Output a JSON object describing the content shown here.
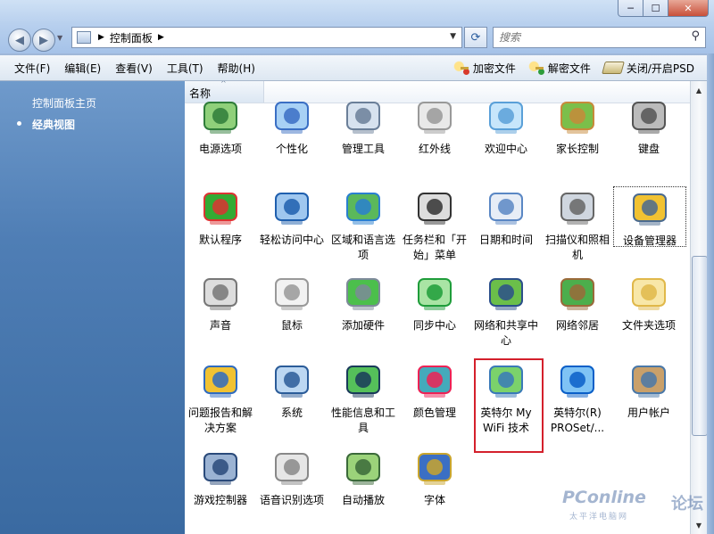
{
  "window": {
    "min": "─",
    "max": "☐",
    "close": "✕"
  },
  "nav": {
    "back": "◀",
    "forward": "▶"
  },
  "address": {
    "path": "控制面板"
  },
  "search": {
    "placeholder": "搜索"
  },
  "menu": [
    "文件(F)",
    "编辑(E)",
    "查看(V)",
    "工具(T)",
    "帮助(H)"
  ],
  "toolbar": {
    "encrypt": "加密文件",
    "decrypt": "解密文件",
    "psd": "关闭/开启PSD"
  },
  "sidebar": {
    "home": "控制面板主页",
    "classic": "经典视图"
  },
  "columns": {
    "name": "名称"
  },
  "icons": [
    {
      "label": "电源选项",
      "icon": "power-options-icon"
    },
    {
      "label": "个性化",
      "icon": "personalization-icon"
    },
    {
      "label": "管理工具",
      "icon": "admin-tools-icon"
    },
    {
      "label": "红外线",
      "icon": "infrared-icon"
    },
    {
      "label": "欢迎中心",
      "icon": "welcome-center-icon"
    },
    {
      "label": "家长控制",
      "icon": "parental-controls-icon"
    },
    {
      "label": "键盘",
      "icon": "keyboard-icon"
    },
    {
      "label": "默认程序",
      "icon": "default-programs-icon"
    },
    {
      "label": "轻松访问中心",
      "icon": "ease-of-access-icon"
    },
    {
      "label": "区域和语言选项",
      "icon": "region-language-icon"
    },
    {
      "label": "任务栏和「开始」菜单",
      "icon": "taskbar-start-icon"
    },
    {
      "label": "日期和时间",
      "icon": "date-time-icon"
    },
    {
      "label": "扫描仪和照相机",
      "icon": "scanner-camera-icon"
    },
    {
      "label": "设备管理器",
      "icon": "device-manager-icon"
    },
    {
      "label": "声音",
      "icon": "sound-icon"
    },
    {
      "label": "鼠标",
      "icon": "mouse-icon"
    },
    {
      "label": "添加硬件",
      "icon": "add-hardware-icon"
    },
    {
      "label": "同步中心",
      "icon": "sync-center-icon"
    },
    {
      "label": "网络和共享中心",
      "icon": "network-sharing-icon"
    },
    {
      "label": "网络邻居",
      "icon": "network-places-icon"
    },
    {
      "label": "文件夹选项",
      "icon": "folder-options-icon"
    },
    {
      "label": "问题报告和解决方案",
      "icon": "problem-reports-icon"
    },
    {
      "label": "系统",
      "icon": "system-icon"
    },
    {
      "label": "性能信息和工具",
      "icon": "performance-icon"
    },
    {
      "label": "颜色管理",
      "icon": "color-management-icon"
    },
    {
      "label": "英特尔 My WiFi 技术",
      "icon": "intel-my-wifi-icon"
    },
    {
      "label": "英特尔(R) PROSet/...",
      "icon": "intel-proset-icon"
    },
    {
      "label": "用户帐户",
      "icon": "user-accounts-icon"
    },
    {
      "label": "游戏控制器",
      "icon": "game-controllers-icon"
    },
    {
      "label": "语音识别选项",
      "icon": "speech-recognition-icon"
    },
    {
      "label": "自动播放",
      "icon": "autoplay-icon"
    },
    {
      "label": "字体",
      "icon": "fonts-icon"
    }
  ],
  "watermark": {
    "main": "PConline",
    "sub": "太平洋电脑网",
    "side": "论坛"
  },
  "colors": {
    "highlight": "#d4202c",
    "sidebar": "#4f7eb5"
  }
}
